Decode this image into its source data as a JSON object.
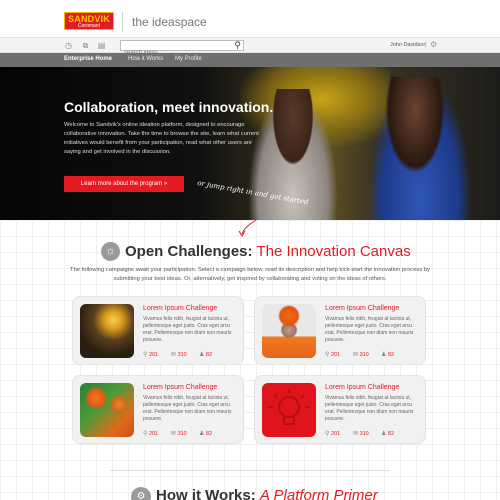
{
  "brand": {
    "logo_line1": "SANDVIK",
    "logo_line2": "Coromant",
    "app_name": "the ideaspace"
  },
  "toolbar": {
    "icons": [
      "clock-icon",
      "share-icon",
      "document-icon"
    ],
    "search_placeholder": "search ideas...",
    "user_name": "John Davidson",
    "separator": "|"
  },
  "nav": {
    "items": [
      {
        "label": "Enterprise Home",
        "active": true
      },
      {
        "label": "How it Works",
        "active": false
      },
      {
        "label": "My Profile",
        "active": false
      }
    ]
  },
  "hero": {
    "title": "Collaboration, meet innovation.",
    "text": "Welcome to Sandvik's online ideation platform, designed to encourage collaborative innovation. Take the time to browse the site, learn what current initiatives would benefit from your participation, read what other users are saying and get involved in the discussion.",
    "button": "Learn more about the program »",
    "note": "or jump right in and get started"
  },
  "section": {
    "title_bold": "Open Challenges:",
    "title_accent": "The Innovation Canvas",
    "description": "The following campaigns await your participation. Select a campaign below, read its description and help kick-start the innovation process by submitting your best ideas. Or, alternatively, get inspired by collaborating and voting on the ideas of others."
  },
  "cards": [
    {
      "title": "Lorem Ipsum Challenge",
      "text": "Vivamus felis nibh, feugiat at lacinia ut, pellentesque eget justo. Cras eget arcu erat. Pellentesque non diam non mauris posuere.",
      "ideas": "201",
      "comments": "310",
      "members": "82",
      "image": "miner-photo"
    },
    {
      "title": "Lorem Ipsum Challenge",
      "text": "Vivamus felis nibh, feugiat at lacinia ut, pellentesque eget justo. Cras eget arcu erat. Pellentesque non diam non mauris posuere.",
      "ideas": "201",
      "comments": "310",
      "members": "82",
      "image": "worker-hardhat-photo"
    },
    {
      "title": "Lorem Ipsum Challenge",
      "text": "Vivamus felis nibh, feugiat at lacinia ut, pellentesque eget justo. Cras eget arcu erat. Pellentesque non diam non mauris posuere.",
      "ideas": "201",
      "comments": "310",
      "members": "82",
      "image": "workers-team-photo"
    },
    {
      "title": "Lorem Ipsum Challenge",
      "text": "Vivamus felis nibh, feugiat at lacinia ut, pellentesque eget justo. Cras eget arcu erat. Pellentesque non diam non mauris posuere.",
      "ideas": "201",
      "comments": "310",
      "members": "82",
      "image": "lightbulb-graphic"
    }
  ],
  "bottom": {
    "title_bold": "How it Works:",
    "title_accent": "A Platform Primer"
  },
  "colors": {
    "accent": "#e31b23",
    "nav_bg": "#6f6f6f",
    "card_bg": "#f1f1f1",
    "logo_yellow": "#f6c800"
  }
}
